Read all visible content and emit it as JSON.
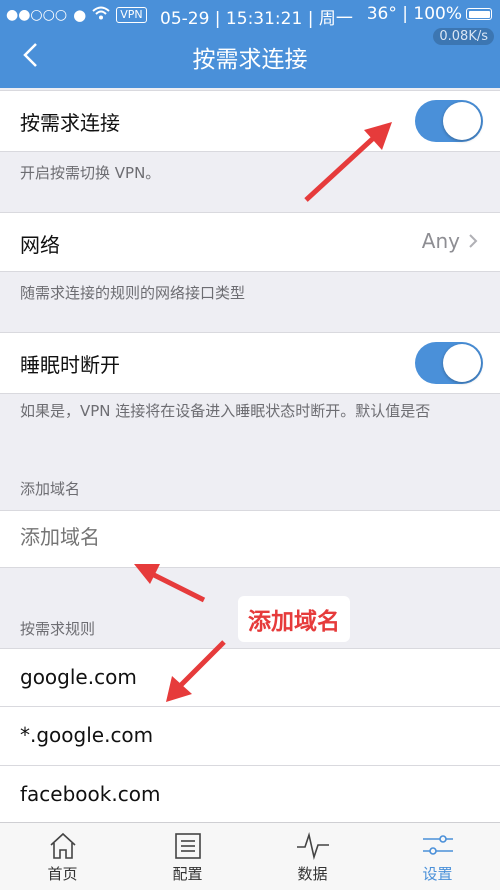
{
  "status_bar": {
    "signal": "●●○○○",
    "vpn_badge": "VPN",
    "date_time": "05-29 | 15:31:21 | 周一",
    "temperature_battery": "36° | 100%",
    "network_speed": "0.08K/s"
  },
  "nav": {
    "title": "按需求连接"
  },
  "on_demand": {
    "label": "按需求连接",
    "enabled": true,
    "note": "开启按需切换 VPN。"
  },
  "network": {
    "label": "网络",
    "value": "Any",
    "note": "随需求连接的规则的网络接口类型"
  },
  "sleep_disconnect": {
    "label": "睡眠时断开",
    "enabled": true,
    "note": "如果是，VPN 连接将在设备进入睡眠状态时断开。默认值是否"
  },
  "add_domain": {
    "section_header": "添加域名",
    "placeholder": "添加域名"
  },
  "callout": {
    "text": "添加域名"
  },
  "rules": {
    "section_header": "按需求规则",
    "items": [
      "google.com",
      "*.google.com",
      "facebook.com"
    ]
  },
  "tabbar": {
    "items": [
      {
        "label": "首页",
        "icon": "home-icon"
      },
      {
        "label": "配置",
        "icon": "list-icon"
      },
      {
        "label": "数据",
        "icon": "pulse-icon"
      },
      {
        "label": "设置",
        "icon": "sliders-icon"
      }
    ]
  },
  "colors": {
    "accent": "#4a90d9",
    "annotation": "#e63b3b"
  }
}
